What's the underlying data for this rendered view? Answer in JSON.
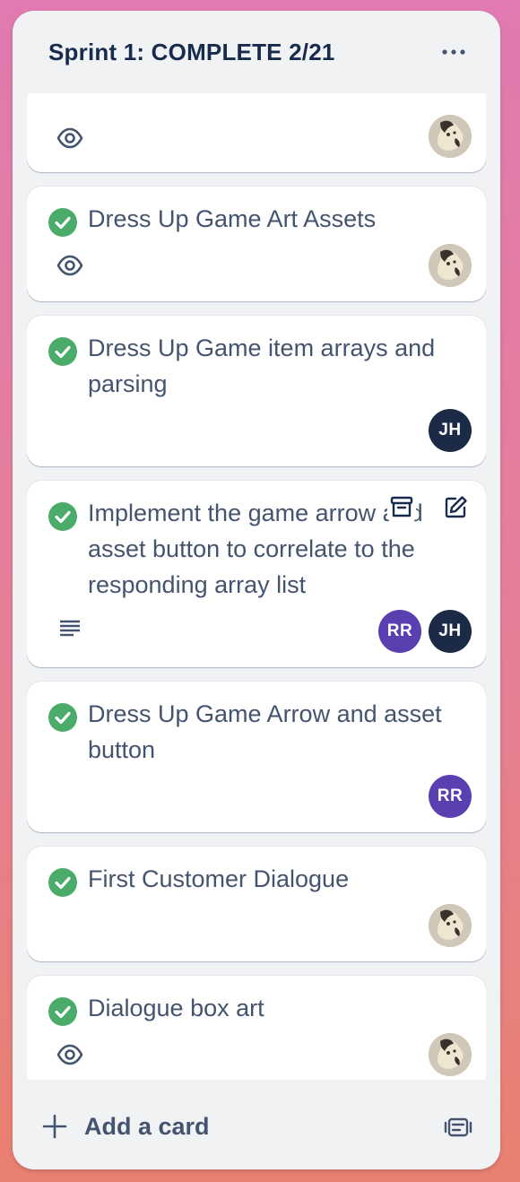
{
  "list": {
    "title": "Sprint 1: COMPLETE 2/21",
    "menu_icon": "more-horizontal-icon"
  },
  "cards": [
    {
      "title": "",
      "completed": false,
      "badges": [
        "eye-icon"
      ],
      "members": [
        "photo"
      ]
    },
    {
      "title": "Dress Up Game Art Assets",
      "completed": true,
      "badges": [
        "eye-icon"
      ],
      "members": [
        "photo"
      ]
    },
    {
      "title": "Dress Up Game item arrays and parsing",
      "completed": true,
      "badges": [],
      "members": [
        "JH"
      ]
    },
    {
      "title": "Implement the game arrow and asset button to correlate to the responding array list",
      "completed": true,
      "badges": [
        "description-icon"
      ],
      "members": [
        "RR",
        "JH"
      ],
      "hover_actions": [
        "archive-icon",
        "edit-icon"
      ]
    },
    {
      "title": "Dress Up Game Arrow and asset button",
      "completed": true,
      "badges": [],
      "members": [
        "RR"
      ]
    },
    {
      "title": "First Customer Dialogue",
      "completed": true,
      "badges": [],
      "members": [
        "photo"
      ]
    },
    {
      "title": "Dialogue box art",
      "completed": true,
      "badges": [
        "eye-icon"
      ],
      "members": [
        "photo"
      ]
    }
  ],
  "avatars": {
    "jh": "JH",
    "rr": "RR"
  },
  "footer": {
    "add_card_label": "Add a card",
    "add_icon": "plus-icon",
    "template_icon": "card-template-icon"
  },
  "colors": {
    "complete_green": "#4bab6b",
    "jh_avatar": "#1b2a47",
    "rr_avatar": "#5a3fb0",
    "list_bg": "#f1f2f4",
    "title_text": "#172b4d",
    "card_text": "#44546f"
  }
}
